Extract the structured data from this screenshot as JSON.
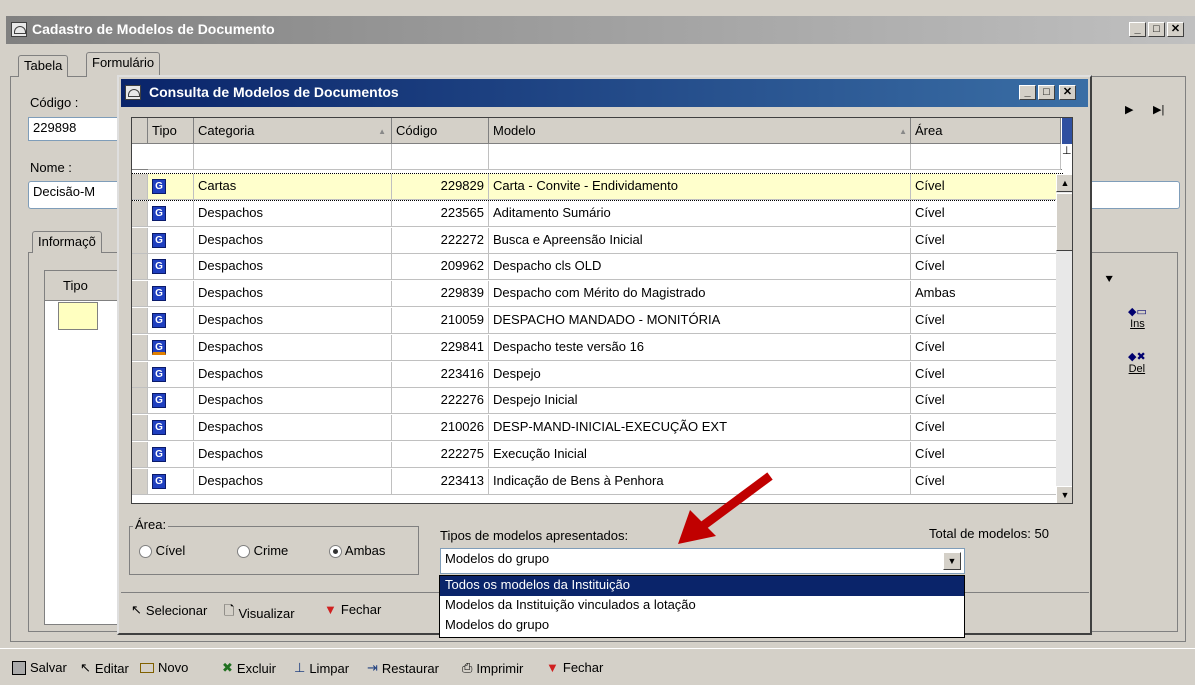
{
  "main_window": {
    "title": "Cadastro de Modelos de Documento",
    "tabs": [
      "Tabela",
      "Formulário"
    ],
    "codigo_label": "Código :",
    "codigo_value": "229898",
    "nome_label": "Nome :",
    "nome_value": "Decisão-M",
    "info_tab": "Informaçõ",
    "inner_grid_header": "Tipo",
    "side_buttons": {
      "ins": "Ins",
      "del": "Del"
    },
    "toolbar": [
      "Salvar",
      "Editar",
      "Novo",
      "Excluir",
      "Limpar",
      "Restaurar",
      "Imprimir",
      "Fechar"
    ]
  },
  "dialog": {
    "title": "Consulta de Modelos de Documentos",
    "columns": [
      "Tipo",
      "Categoria",
      "Código",
      "Modelo",
      "Área"
    ],
    "rows": [
      {
        "categoria": "Cartas",
        "codigo": "229829",
        "modelo": "Carta - Convite - Endividamento",
        "area": "Cível"
      },
      {
        "categoria": "Despachos",
        "codigo": "223565",
        "modelo": "Aditamento Sumário",
        "area": "Cível"
      },
      {
        "categoria": "Despachos",
        "codigo": "222272",
        "modelo": "Busca e Apreensão Inicial",
        "area": "Cível"
      },
      {
        "categoria": "Despachos",
        "codigo": "209962",
        "modelo": "Despacho cls OLD",
        "area": "Cível"
      },
      {
        "categoria": "Despachos",
        "codigo": "229839",
        "modelo": "Despacho com Mérito do Magistrado",
        "area": "Ambas"
      },
      {
        "categoria": "Despachos",
        "codigo": "210059",
        "modelo": "DESPACHO MANDADO - MONITÓRIA",
        "area": "Cível"
      },
      {
        "categoria": "Despachos",
        "codigo": "229841",
        "modelo": "Despacho teste versão 16",
        "area": "Cível"
      },
      {
        "categoria": "Despachos",
        "codigo": "223416",
        "modelo": "Despejo",
        "area": "Cível"
      },
      {
        "categoria": "Despachos",
        "codigo": "222276",
        "modelo": "Despejo Inicial",
        "area": "Cível"
      },
      {
        "categoria": "Despachos",
        "codigo": "210026",
        "modelo": "DESP-MAND-INICIAL-EXECUÇÃO EXT",
        "area": "Cível"
      },
      {
        "categoria": "Despachos",
        "codigo": "222275",
        "modelo": "Execução Inicial",
        "area": "Cível"
      },
      {
        "categoria": "Despachos",
        "codigo": "223413",
        "modelo": "Indicação de Bens à Penhora",
        "area": "Cível"
      }
    ],
    "area_group": {
      "label": "Área:",
      "options": [
        "Cível",
        "Crime",
        "Ambas"
      ],
      "selected": "Ambas"
    },
    "tipos_label": "Tipos de modelos apresentados:",
    "total_label": "Total de modelos: 50",
    "dropdown": {
      "selected": "Modelos do grupo",
      "options": [
        "Todos os modelos da Instituição",
        "Modelos da Instituição vinculados a lotação",
        "Modelos do grupo"
      ],
      "highlighted_index": 0
    },
    "toolbar": [
      "Selecionar",
      "Visualizar",
      "Fechar"
    ]
  },
  "colors": {
    "selected_row": "#ffffcc",
    "highlight": "#0a246a",
    "arrow": "#c00000"
  }
}
